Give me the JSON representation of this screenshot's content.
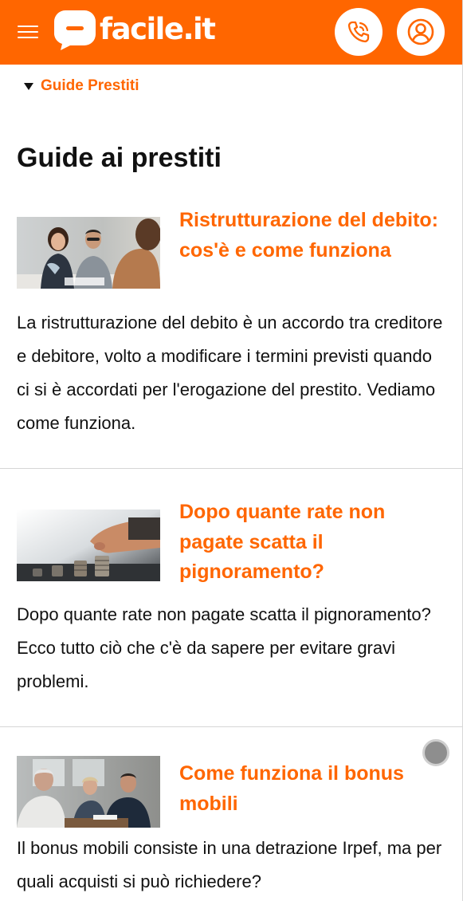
{
  "header": {
    "brand": "facile.it",
    "menu_icon": "hamburger-menu-icon",
    "phone_icon": "phone-icon",
    "user_icon": "user-account-icon",
    "brand_color": "#ff6600"
  },
  "breadcrumb": {
    "label": "Guide Prestiti",
    "icon": "triangle-down-icon"
  },
  "page_title": "Guide ai prestiti",
  "articles": [
    {
      "title": "Ristrutturazione del debito: cos'è e come funziona",
      "description": "La ristrutturazione del debito è un accordo tra creditore e debitore, volto a modificare i termini previsti quando ci si è accordati per l'erogazione del prestito. Vediamo come funziona."
    },
    {
      "title": "Dopo quante rate non pagate scatta il pignoramento?",
      "description": "Dopo quante rate non pagate scatta il pignoramento? Ecco tutto ciò che c'è da sapere per evitare gravi problemi."
    },
    {
      "title": "Come funziona il bonus mobili",
      "description": "Il bonus mobili consiste in una detrazione Irpef, ma per quali acquisti si può richiedere?"
    }
  ]
}
